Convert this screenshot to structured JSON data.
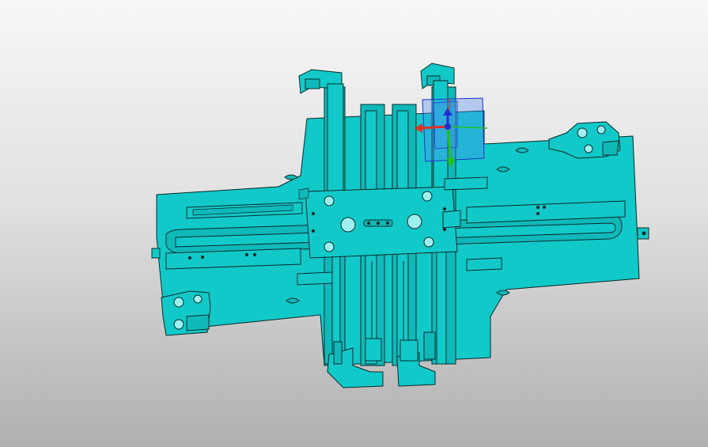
{
  "viewport": {
    "background_top": "#f7f7f7",
    "background_bottom": "#b0b0b0"
  },
  "model": {
    "body_color": "#12c9c9",
    "edge_color": "#0a2a2a"
  },
  "triad": {
    "x_axis_color": "#e03020",
    "y_axis_color": "#20c020",
    "z_axis_color": "#2030d0",
    "plane_color": "#4a8cf0",
    "icon": "xyz-manipulator-icon"
  }
}
